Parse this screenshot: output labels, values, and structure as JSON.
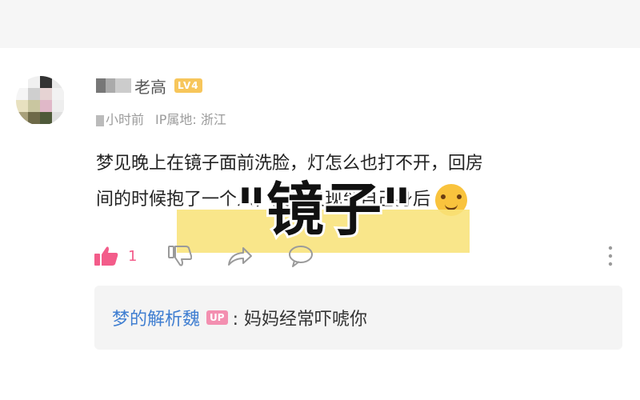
{
  "comment": {
    "username": "老高",
    "level_badge": "LV4",
    "time": "小时前",
    "ip_location": "IP属地: 浙江",
    "text_line1": "梦见晚上在镜子面前洗脸，灯怎么也打不开，回房",
    "text_line2": "间的时候抱了一个人，突然发现到自己身后",
    "emoji": "cat-face-emoji",
    "like_count": "1"
  },
  "overlay": {
    "title": "\"镜子\""
  },
  "reply": {
    "author": "梦的解析魏",
    "badge": "UP",
    "text": ": 妈妈经常吓唬你"
  },
  "colors": {
    "like": "#f35c8a",
    "reply_author": "#3f7ed1",
    "overlay_bg": "#f8e27a"
  }
}
